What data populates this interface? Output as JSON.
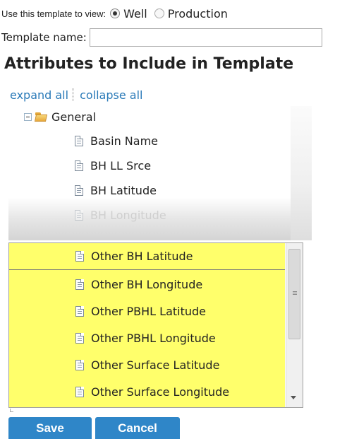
{
  "view_selector": {
    "label": "Use this template to view:",
    "options": [
      {
        "label": "Well",
        "checked": true
      },
      {
        "label": "Production",
        "checked": false
      }
    ]
  },
  "template_name": {
    "label": "Template name:",
    "value": "",
    "placeholder": ""
  },
  "section_title": "Attributes to Include in Template",
  "tree_controls": {
    "expand_all": "expand all",
    "collapse_all": "collapse all"
  },
  "tree": {
    "folder": {
      "label": "General",
      "icon": "folder-open-icon",
      "expanded": true
    },
    "items": [
      {
        "label": "Basin Name",
        "icon": "document-icon"
      },
      {
        "label": "BH LL Srce",
        "icon": "document-icon"
      },
      {
        "label": "BH Latitude",
        "icon": "document-icon"
      },
      {
        "label": "BH Longitude",
        "icon": "document-icon"
      }
    ]
  },
  "dropdown": {
    "highlight_color": "#ffff6b",
    "items": [
      {
        "label": "Other BH Latitude",
        "icon": "document-icon",
        "selected": true
      },
      {
        "label": "Other BH Longitude",
        "icon": "document-icon",
        "selected": false
      },
      {
        "label": "Other PBHL Latitude",
        "icon": "document-icon",
        "selected": false
      },
      {
        "label": "Other PBHL Longitude",
        "icon": "document-icon",
        "selected": false
      },
      {
        "label": "Other Surface Latitude",
        "icon": "document-icon",
        "selected": false
      },
      {
        "label": "Other Surface Longitude",
        "icon": "document-icon",
        "selected": false
      }
    ]
  },
  "buttons": {
    "save": "Save",
    "cancel": "Cancel",
    "color": "#2f86c8"
  }
}
